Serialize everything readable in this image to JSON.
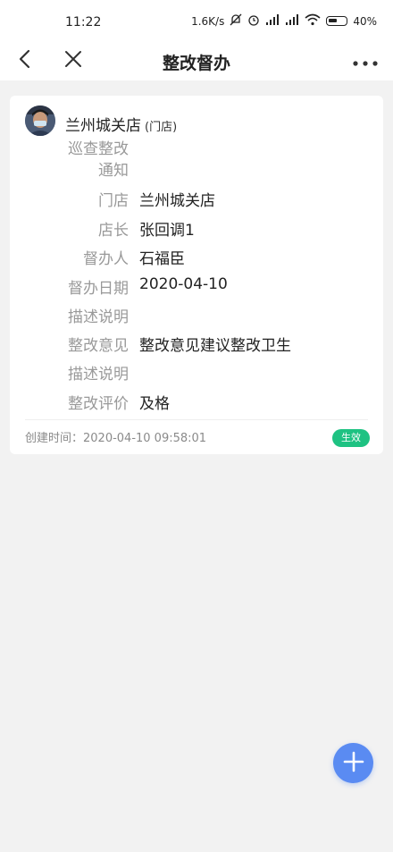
{
  "status_bar": {
    "time": "11:22",
    "network_speed": "1.6K/s",
    "battery": "40%"
  },
  "nav": {
    "title": "整改督办"
  },
  "card": {
    "store_name": "兰州城关店",
    "store_type": "(门店)",
    "rows": [
      {
        "label": "巡查整改通知",
        "value": ""
      },
      {
        "label": "门店",
        "value": "兰州城关店"
      },
      {
        "label": "店长",
        "value": "张回调1"
      },
      {
        "label": "督办人",
        "value": "石福臣"
      },
      {
        "label": "督办日期",
        "value": "2020-04-10"
      },
      {
        "label": "描述说明",
        "value": ""
      },
      {
        "label": "整改意见",
        "value": "整改意见建议整改卫生"
      },
      {
        "label": "描述说明",
        "value": ""
      },
      {
        "label": "整改评价",
        "value": "及格"
      }
    ],
    "created_text": "创建时间：2020-04-10 09:58:01",
    "status_badge": "生效"
  },
  "colors": {
    "badge": "#1ec282",
    "fab": "#5a8bf2",
    "label": "#999999"
  },
  "icons": {
    "back": "chevron-left-icon",
    "close": "close-icon",
    "more": "more-horizontal-icon",
    "fab": "plus-icon"
  }
}
